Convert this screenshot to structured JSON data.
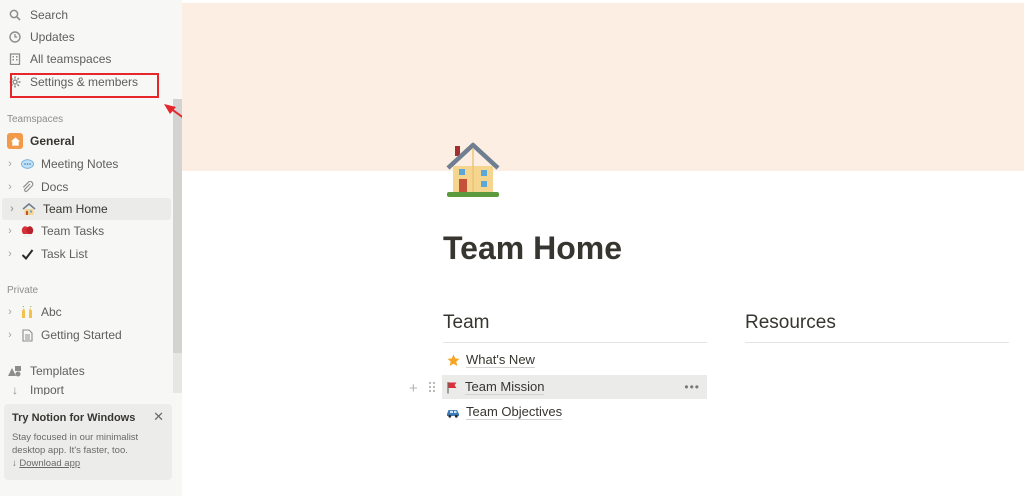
{
  "sidebar": {
    "top_items": [
      {
        "label": "Search",
        "icon": "search-icon"
      },
      {
        "label": "Updates",
        "icon": "clock-icon"
      },
      {
        "label": "All teamspaces",
        "icon": "building-icon"
      },
      {
        "label": "Settings & members",
        "icon": "gear-icon"
      }
    ],
    "teamspaces_label": "Teamspaces",
    "general_label": "General",
    "team_pages": [
      {
        "label": "Meeting Notes",
        "icon": "speech-bubble-icon"
      },
      {
        "label": "Docs",
        "icon": "paperclip-icon"
      },
      {
        "label": "Team Home",
        "icon": "house-icon",
        "active": true
      },
      {
        "label": "Team Tasks",
        "icon": "boxing-glove-icon"
      },
      {
        "label": "Task List",
        "icon": "checkmark-icon"
      }
    ],
    "private_label": "Private",
    "private_pages": [
      {
        "label": "Abc",
        "icon": "raised-hands-icon"
      },
      {
        "label": "Getting Started",
        "icon": "page-icon"
      }
    ],
    "templates_label": "Templates",
    "import_label": "Import",
    "notice": {
      "title": "Try Notion for Windows",
      "body": "Stay focused in our minimalist desktop app. It's faster, too.",
      "link_prefix": "↓",
      "link": "Download app",
      "close": "✕"
    }
  },
  "page": {
    "title": "Team Home",
    "columns": [
      {
        "heading": "Team",
        "items": [
          {
            "label": "What's New",
            "icon": "star-icon"
          },
          {
            "label": "Team Mission",
            "icon": "red-flag-icon"
          },
          {
            "label": "Team Objectives",
            "icon": "car-icon"
          }
        ]
      },
      {
        "heading": "Resources",
        "items": []
      }
    ],
    "more_dots": "•••"
  },
  "colors": {
    "cover": "#fdeee3",
    "sidebar_bg": "#f7f7f5",
    "annotation": "#e5262b"
  }
}
